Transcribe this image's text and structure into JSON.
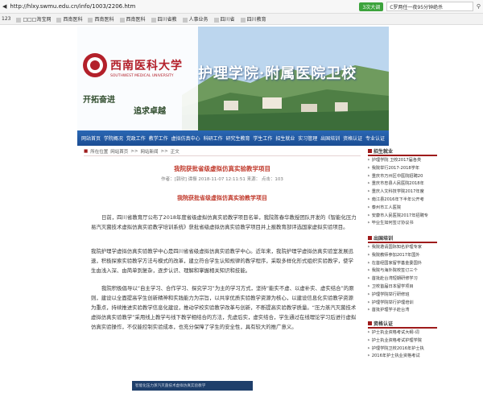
{
  "browser": {
    "url": "http://hlxy.swmu.edu.cn/info/1003/2206.htm",
    "badge": "3次大调",
    "search": "C罗两任一夜95分钟绝杀"
  },
  "bookmarks": [
    "123",
    "□□□淘宝网",
    "西南医科",
    "西南医科",
    "西南医科",
    "四川省教",
    "人事业务",
    "四川省",
    "四川教育"
  ],
  "banner": {
    "logo_text": "西南医科大学",
    "logo_en": "SOUTHWEST MEDICAL UNIVERSITY",
    "college": "护理学院·附属医院卫校",
    "motto_left": "开拓奋进",
    "motto_right": "追求卓越"
  },
  "nav": [
    "网站首页",
    "学院概况",
    "党政工作",
    "教学工作",
    "虚拟仿真中心",
    "科研工作",
    "研究生教育",
    "学生工作",
    "招生就业",
    "实习管理",
    "出国培训",
    "资格认证",
    "专业认证"
  ],
  "breadcrumb": [
    "所在位置",
    "网站首页",
    ">>",
    "网站新闻",
    ">>",
    "正文"
  ],
  "article": {
    "title": "我院获批省级虚拟仿真实验教学项目",
    "meta": "作者：[郭欣]  谭振    2018-11-07 12:11:51  来源：    点击：103",
    "subtitle": "我院获批省级虚拟仿真实验教学项目",
    "paragraphs": [
      "日前，四川省教育厅公布了2018年度省级虚拟仿真实验教学项目名单，我院陈春华教授团队开发的《智能化压力易汽灭菌技术虚拟仿真实验教学培训系统》获批省级虚拟仿真实验教学项目并上报教育部评选国家虚拟实验项目。",
      "我院护理学虚拟仿真实验教学中心是四川省省级虚拟仿真实验教学中心。近年来，我院护理学虚拟仿真实验室发展迅速，积极探索实验教学方法与模式的改革，建立符合学生认知规律的教学程序，采取多样化形式组织实验教学，使学生由浅入深、由简单到复杂，逐步认识、理解和掌握相关知识和技能。",
      "我院积极倡导以“自主学习、合作学习、探究学习”为主的学习方式，坚持“能实不虚、以虚补实、虚实结合”的原则，建设以全面提高学生创新精神和实践能力为宗旨，以共享优质实验教学资源为核心，以建设信息化实验教学资源为重点，持续推进实验教学信息化建设，推动学校实验教学改革与创新，不断提高实验教学质量。“压力蒸汽灭菌技术虚拟仿真实验教学”采用线上教学与线下教学相结合的方法，先虚后实，虚实结合，学生通过在线理论学习后进行虚拟仿真实验操作，不仅能控制实验成本，也充分保障了学生的安全性，具有较大的推广意义。"
    ],
    "image_caption": "智能化压力蒸汽灭菌技术虚拟仿真实验教学"
  },
  "sidebar": [
    {
      "title": "招生就业",
      "items": [
        "护理学院 卫校2017届各类",
        "我院举行2017-2018学年",
        "重庆市万州区中医院招聘20",
        "重庆市忠县人民医院2018年",
        "重庆人文科技学院2017年度",
        "南江县2016年下半年公开考",
        "泰州市工人医院",
        "安康市人民医院2017年招聘专",
        "毕业生如何签订协议书"
      ]
    },
    {
      "title": "出国培训",
      "items": [
        "我院邀请国际知名护理专家",
        "我院教师参加2017年国外",
        "在首经国家留学基金委国外",
        "我院与海外院校签订三个",
        "首批赴台湾短期研修学习",
        "卫校首届日本留学项目",
        "护理学院举行研修班",
        "护理学院举行护理培训",
        "首批护理学子赴台湾"
      ]
    },
    {
      "title": "资格认证",
      "items": [
        "护士执业资格考试大纲-词",
        "护士执业资格考试护理学院",
        "护理学院卫校2016年护士执",
        "2016年护士执业资格考试"
      ]
    }
  ]
}
